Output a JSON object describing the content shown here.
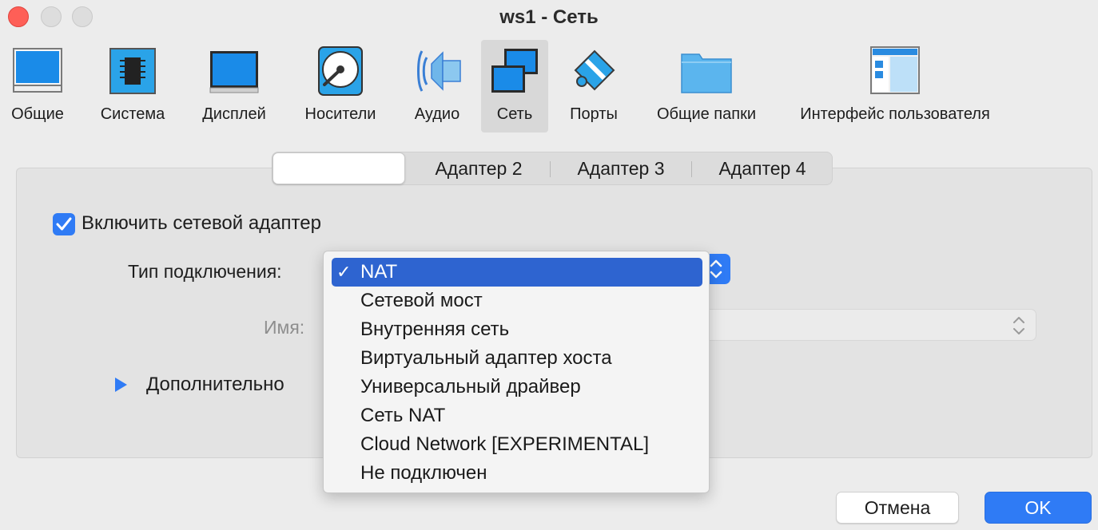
{
  "window": {
    "title": "ws1 - Сеть"
  },
  "toolbar": {
    "items": [
      {
        "label": "Общие",
        "icon": "general-monitor-icon",
        "active": false
      },
      {
        "label": "Система",
        "icon": "chip-icon",
        "active": false
      },
      {
        "label": "Дисплей",
        "icon": "display-icon",
        "active": false
      },
      {
        "label": "Носители",
        "icon": "storage-disk-icon",
        "active": false
      },
      {
        "label": "Аудио",
        "icon": "speaker-icon",
        "active": false
      },
      {
        "label": "Сеть",
        "icon": "network-icon",
        "active": true
      },
      {
        "label": "Порты",
        "icon": "serial-port-icon",
        "active": false
      },
      {
        "label": "Общие папки",
        "icon": "folder-icon",
        "active": false
      },
      {
        "label": "Интерфейс пользователя",
        "icon": "user-interface-icon",
        "active": false
      }
    ]
  },
  "tabs": [
    {
      "label": "",
      "selected": true
    },
    {
      "label": "Адаптер 2",
      "selected": false
    },
    {
      "label": "Адаптер 3",
      "selected": false
    },
    {
      "label": "Адаптер 4",
      "selected": false
    }
  ],
  "form": {
    "enable_adapter_label": "Включить сетевой адаптер",
    "enable_adapter_checked": true,
    "connection_type_label": "Тип подключения:",
    "name_label": "Имя:",
    "advanced_label": "Дополнительно"
  },
  "dropdown": {
    "selected": "NAT",
    "options": [
      "NAT",
      "Сетевой мост",
      "Внутренняя сеть",
      "Виртуальный адаптер хоста",
      "Универсальный драйвер",
      "Сеть NAT",
      "Cloud Network [EXPERIMENTAL]",
      "Не подключен"
    ]
  },
  "buttons": {
    "cancel": "Отмена",
    "ok": "OK"
  },
  "colors": {
    "accent": "#2f7bf5",
    "menu_highlight": "#2e64d0",
    "close": "#fe5f57"
  }
}
